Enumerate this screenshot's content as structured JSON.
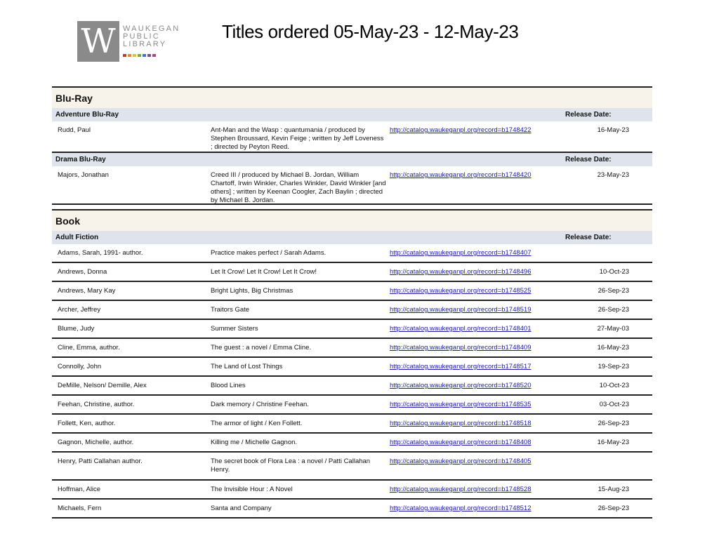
{
  "logo": {
    "lines": [
      "WAUKEGAN",
      "PUBLIC",
      "LIBRARY"
    ],
    "letter": "W",
    "dot_colors": [
      "#c8362e",
      "#e08a2c",
      "#e5c12a",
      "#7aab3a",
      "#3a7bbf",
      "#7a4e9e",
      "#c43a7a"
    ]
  },
  "page_title": "Titles ordered 05-May-23 - 12-May-23",
  "sections": [
    {
      "name": "Blu-Ray",
      "categories": [
        {
          "name": "Adventure Blu-Ray",
          "release_header": "Release Date:",
          "rows": [
            {
              "author": "Rudd, Paul",
              "title": "Ant-Man and the Wasp : quantumania / produced by Stephen Broussard, Kevin Feige ; written by Jeff Loveness ; directed by Peyton Reed.",
              "link": "http://catalog.waukeganpl.org/record=b1748422",
              "date": "16-May-23"
            }
          ]
        },
        {
          "name": "Drama Blu-Ray",
          "release_header": "Release Date:",
          "rows": [
            {
              "author": "Majors, Jonathan",
              "title": "Creed III / produced by Michael B. Jordan, William Chartoff, Irwin Winkler, Charles Winkler, David Winkler [and others] ; written by Keenan Coogler, Zach Baylin ; directed by Michael B. Jordan.",
              "link": "http://catalog.waukeganpl.org/record=b1748420",
              "date": "23-May-23"
            }
          ]
        }
      ]
    },
    {
      "name": "Book",
      "categories": [
        {
          "name": "Adult Fiction",
          "release_header": "Release Date:",
          "rows": [
            {
              "author": "Adams, Sarah, 1991- author.",
              "title": "Practice makes perfect / Sarah Adams.",
              "link": "http://catalog.waukeganpl.org/record=b1748407",
              "date": ""
            },
            {
              "author": "Andrews, Donna",
              "title": "Let It Crow! Let It Crow! Let It Crow!",
              "link": "http://catalog.waukeganpl.org/record=b1748496",
              "date": "10-Oct-23"
            },
            {
              "author": "Andrews, Mary Kay",
              "title": "Bright Lights, Big Christmas",
              "link": "http://catalog.waukeganpl.org/record=b1748525",
              "date": "26-Sep-23"
            },
            {
              "author": "Archer, Jeffrey",
              "title": "Traitors Gate",
              "link": "http://catalog.waukeganpl.org/record=b1748519",
              "date": "26-Sep-23"
            },
            {
              "author": "Blume, Judy",
              "title": "Summer Sisters",
              "link": "http://catalog.waukeganpl.org/record=b1748401",
              "date": "27-May-03"
            },
            {
              "author": "Cline, Emma, author.",
              "title": "The guest : a novel / Emma Cline.",
              "link": "http://catalog.waukeganpl.org/record=b1748409",
              "date": "16-May-23"
            },
            {
              "author": "Connolly, John",
              "title": "The Land of Lost Things",
              "link": "http://catalog.waukeganpl.org/record=b1748517",
              "date": "19-Sep-23"
            },
            {
              "author": "DeMille, Nelson/ Demille, Alex",
              "title": "Blood Lines",
              "link": "http://catalog.waukeganpl.org/record=b1748520",
              "date": "10-Oct-23"
            },
            {
              "author": "Feehan, Christine, author.",
              "title": "Dark memory / Christine Feehan.",
              "link": "http://catalog.waukeganpl.org/record=b1748535",
              "date": "03-Oct-23"
            },
            {
              "author": "Follett, Ken, author.",
              "title": "The armor of light / Ken Follett.",
              "link": "http://catalog.waukeganpl.org/record=b1748518",
              "date": "26-Sep-23"
            },
            {
              "author": "Gagnon, Michelle, author.",
              "title": "Killing me / Michelle Gagnon.",
              "link": "http://catalog.waukeganpl.org/record=b1748408",
              "date": "16-May-23"
            },
            {
              "author": "Henry, Patti Callahan author.",
              "title": "The secret book of Flora Lea : a novel / Patti Callahan Henry.",
              "link": "http://catalog.waukeganpl.org/record=b1748405",
              "date": ""
            },
            {
              "author": "Hoffman, Alice",
              "title": "The Invisible Hour : A Novel",
              "link": "http://catalog.waukeganpl.org/record=b1748528",
              "date": "15-Aug-23"
            },
            {
              "author": "Michaels, Fern",
              "title": "Santa and Company",
              "link": "http://catalog.waukeganpl.org/record=b1748512",
              "date": "26-Sep-23"
            }
          ]
        }
      ]
    }
  ]
}
